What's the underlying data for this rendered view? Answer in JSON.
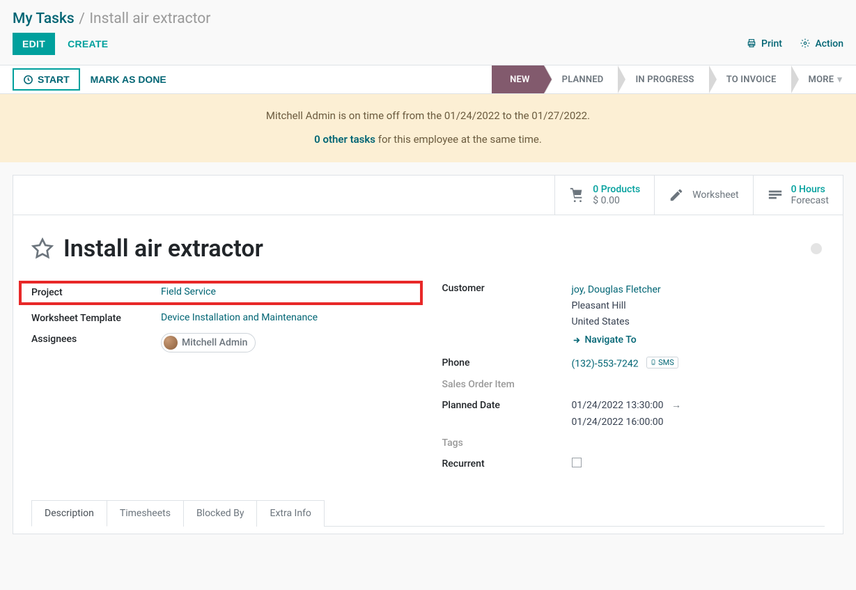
{
  "breadcrumb": {
    "parent": "My Tasks",
    "current": "Install air extractor"
  },
  "toolbar": {
    "edit": "EDIT",
    "create": "CREATE",
    "print": "Print",
    "action": "Action"
  },
  "status_buttons": {
    "start": "START",
    "mark_done": "MARK AS DONE"
  },
  "stages": {
    "new": "NEW",
    "planned": "PLANNED",
    "in_progress": "IN PROGRESS",
    "to_invoice": "TO INVOICE",
    "more": "MORE"
  },
  "notice": {
    "line1": "Mitchell Admin is on time off from the 01/24/2022 to the 01/27/2022.",
    "other_tasks_link": "0 other tasks",
    "other_tasks_text": " for this employee at the same time."
  },
  "stats": {
    "products_top": "0 Products",
    "products_bottom": "$ 0.00",
    "worksheet": "Worksheet",
    "hours_top": "0  Hours",
    "hours_bottom": "Forecast"
  },
  "title": "Install air extractor",
  "fields": {
    "project_label": "Project",
    "project_value": "Field Service",
    "wt_label": "Worksheet Template",
    "wt_value": "Device Installation and Maintenance",
    "assignees_label": "Assignees",
    "assignee_name": "Mitchell Admin",
    "customer_label": "Customer",
    "customer_name": "joy, Douglas Fletcher",
    "customer_city": "Pleasant Hill",
    "customer_country": "United States",
    "navigate": "Navigate To",
    "phone_label": "Phone",
    "phone_value": "(132)-553-7242",
    "sms": "SMS",
    "soi_label": "Sales Order Item",
    "planned_label": "Planned Date",
    "planned_start": "01/24/2022 13:30:00",
    "planned_end": "01/24/2022 16:00:00",
    "tags_label": "Tags",
    "recurrent_label": "Recurrent"
  },
  "tabs": {
    "description": "Description",
    "timesheets": "Timesheets",
    "blocked_by": "Blocked By",
    "extra_info": "Extra Info"
  }
}
